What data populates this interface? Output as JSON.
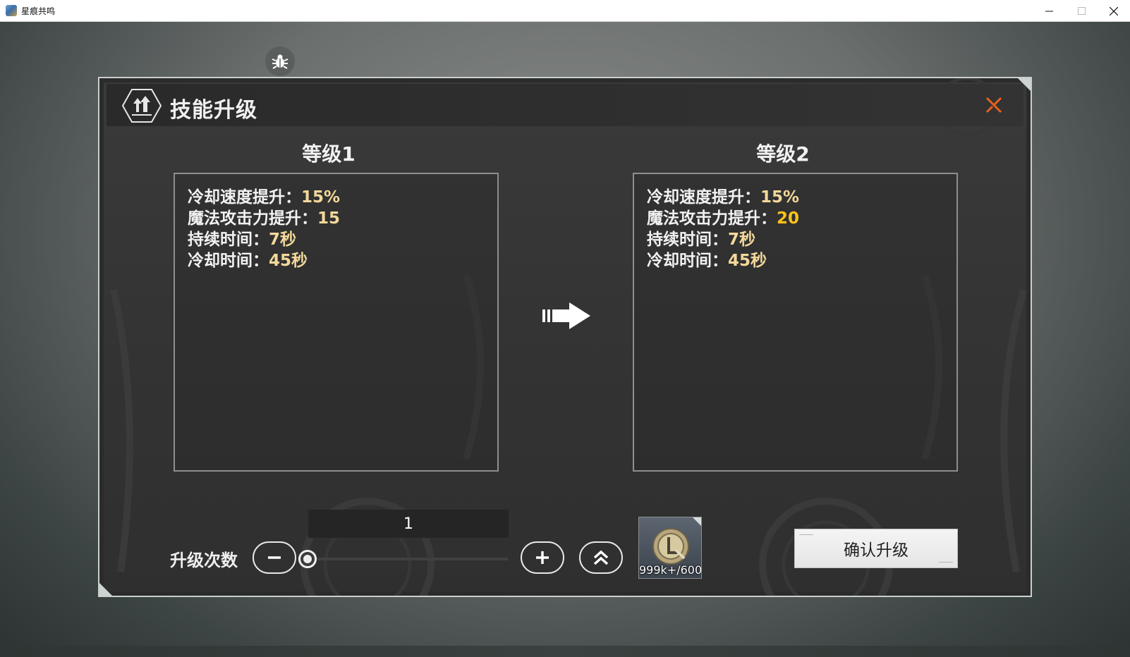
{
  "window": {
    "title": "星痕共鸣",
    "minimize": "–",
    "maximize": "□",
    "close": "✕"
  },
  "dialog": {
    "title": "技能升级",
    "close_icon": "close-x-icon",
    "accent_color": "#e8601c"
  },
  "current": {
    "level_label": "等级1",
    "stats": [
      {
        "label": "冷却速度提升：",
        "value": "15%"
      },
      {
        "label": "魔法攻击力提升：",
        "value": "15"
      },
      {
        "label": "持续时间：",
        "value": "7秒"
      },
      {
        "label": "冷却时间：",
        "value": "45秒"
      }
    ]
  },
  "next": {
    "level_label": "等级2",
    "stats": [
      {
        "label": "冷却速度提升：",
        "value": "15%"
      },
      {
        "label": "魔法攻击力提升：",
        "value": "20"
      },
      {
        "label": "持续时间：",
        "value": "7秒"
      },
      {
        "label": "冷却时间：",
        "value": "45秒"
      }
    ]
  },
  "upgrade": {
    "label": "升级次数",
    "count": "1",
    "slider_fraction": 0
  },
  "cost": {
    "amount": "999k+/600",
    "icon": "coin-icon"
  },
  "confirm_label": "确认升级"
}
